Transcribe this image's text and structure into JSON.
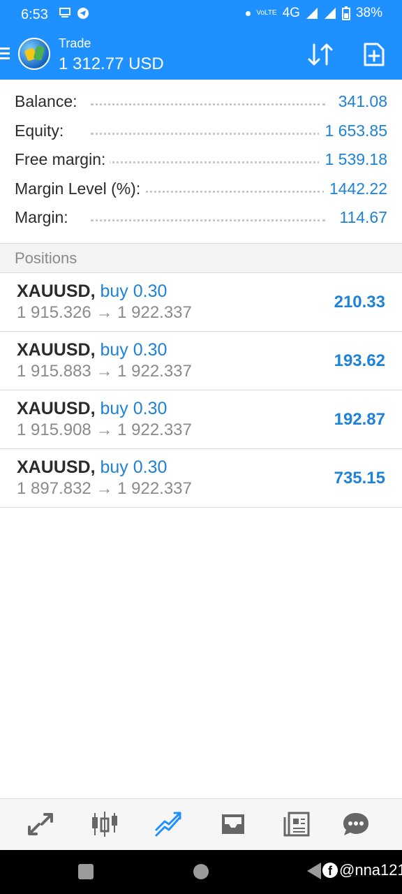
{
  "status_bar": {
    "time": "6:53",
    "network": "4G",
    "volte": "VoLTE",
    "battery": "38%"
  },
  "header": {
    "title": "Trade",
    "balance": "1 312.77 USD"
  },
  "summary": [
    {
      "label": "Balance:",
      "value": "341.08"
    },
    {
      "label": "Equity:",
      "value": "1 653.85"
    },
    {
      "label": "Free margin:",
      "value": "1 539.18"
    },
    {
      "label": "Margin Level (%):",
      "value": "1442.22"
    },
    {
      "label": "Margin:",
      "value": "114.67"
    }
  ],
  "positions_header": "Positions",
  "positions": [
    {
      "symbol": "XAUUSD,",
      "direction": "buy 0.30",
      "prices": "1 915.326 → 1 922.337",
      "profit": "210.33"
    },
    {
      "symbol": "XAUUSD,",
      "direction": "buy 0.30",
      "prices": "1 915.883 → 1 922.337",
      "profit": "193.62"
    },
    {
      "symbol": "XAUUSD,",
      "direction": "buy 0.30",
      "prices": "1 915.908 → 1 922.337",
      "profit": "192.87"
    },
    {
      "symbol": "XAUUSD,",
      "direction": "buy 0.30",
      "prices": "1 897.832 → 1 922.337",
      "profit": "735.15"
    }
  ],
  "tabs": [
    {
      "icon": "quotes-icon",
      "active": false
    },
    {
      "icon": "chart-icon",
      "active": false
    },
    {
      "icon": "trade-icon",
      "active": true
    },
    {
      "icon": "history-icon",
      "active": false
    },
    {
      "icon": "news-icon",
      "active": false
    },
    {
      "icon": "messages-icon",
      "active": false
    }
  ],
  "watermark": "@nna121",
  "colors": {
    "accent": "#1e90ff",
    "value_blue": "#1e82d8",
    "label_dark": "#2b2b2b",
    "muted": "#8a8a8a",
    "tab_inactive": "#666666"
  }
}
